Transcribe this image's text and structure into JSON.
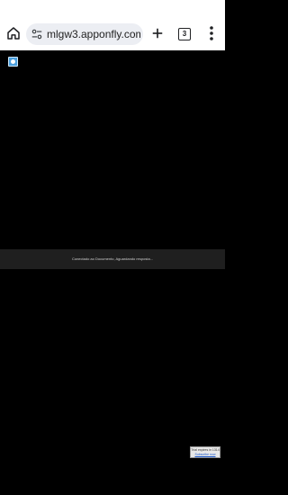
{
  "browser": {
    "url": "mlgw3.apponfly.com",
    "tab_count": "3",
    "icons": {
      "home": "home-icon",
      "site_settings": "tune-icon",
      "new_tab": "plus-icon",
      "tabs": "tab-switcher-icon",
      "menu": "more-vert-icon"
    }
  },
  "page": {
    "favicon": "app-favicon-icon",
    "status_message": "Conectado ao Documento, Aguardando resposta...",
    "trial_notice": "Trial expires in 1314",
    "subscribe_label": "Subscribe now"
  },
  "colors": {
    "background": "#000000",
    "toolbar": "#ffffff",
    "urlbar": "#eceef3",
    "banner": "#1f1f1f",
    "link": "#1a56c9"
  }
}
